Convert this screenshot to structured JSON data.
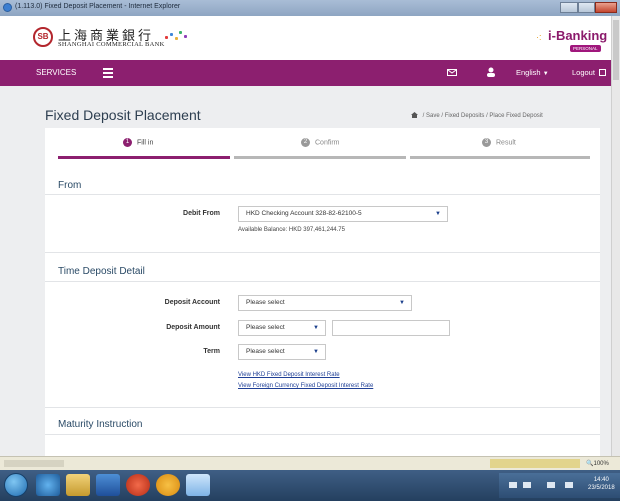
{
  "window": {
    "title": "(1.113.0) Fixed Deposit Placement - Internet Explorer"
  },
  "header": {
    "bank_name_cn": "上海商業銀行",
    "bank_name_en": "SHANGHAI COMMERCIAL BANK",
    "logo_mark": "SB",
    "product_name": "i-Banking",
    "product_tag": "PERSONAL"
  },
  "nav": {
    "services_label": "SERVICES",
    "language_label": "English",
    "logout_label": "Logout",
    "colors": {
      "bar": "#8c1f6f"
    }
  },
  "page": {
    "title": "Fixed Deposit Placement",
    "breadcrumb": [
      "Save",
      "Fixed Deposits",
      "Place Fixed Deposit"
    ]
  },
  "steps": [
    {
      "num": "1",
      "label": "Fill in",
      "active": true
    },
    {
      "num": "2",
      "label": "Confirm",
      "active": false
    },
    {
      "num": "3",
      "label": "Result",
      "active": false
    }
  ],
  "from_section": {
    "title": "From",
    "debit_label": "Debit From",
    "debit_value": "HKD Checking Account 328-82-62100-5",
    "available_balance": "Available Balance: HKD 397,461,244.75"
  },
  "detail_section": {
    "title": "Time Deposit Detail",
    "account_label": "Deposit Account",
    "account_value": "Please select",
    "amount_label": "Deposit Amount",
    "amount_currency": "Please select",
    "amount_value": "",
    "term_label": "Term",
    "term_value": "Please select",
    "link_hkd": "View HKD Fixed Deposit Interest Rate",
    "link_foreign": "View Foreign Currency Fixed Deposit Interest Rate"
  },
  "maturity_section": {
    "title": "Maturity Instruction"
  },
  "statusbar": {
    "zoom": "100%"
  },
  "taskbar": {
    "time": "14:40",
    "date": "23/5/2018"
  }
}
